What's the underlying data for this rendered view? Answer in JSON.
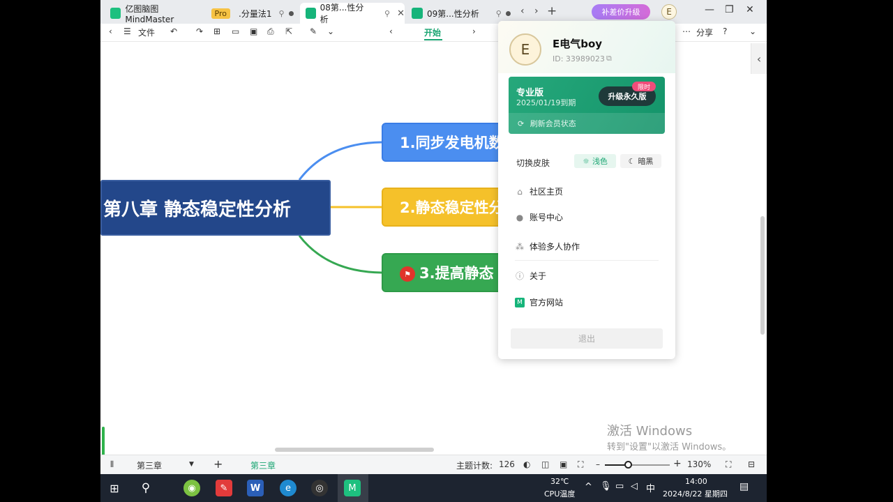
{
  "titlebar": {
    "tabs": [
      {
        "label": "亿图脑图MindMaster",
        "badge": "Pro"
      },
      {
        "label": ".分量法1"
      },
      {
        "label": "08第...性分析"
      },
      {
        "label": "09第...性分析"
      }
    ],
    "upgrade_label": "补差价升级",
    "avatar_letter": "E"
  },
  "toolbar": {
    "file_label": "文件",
    "start_label": "开始",
    "share_label": "分享"
  },
  "mindmap": {
    "central": "第八章 静态稳定性分析",
    "branches": [
      {
        "label": "1.同步发电机数",
        "color": "#4b8ef0"
      },
      {
        "label": "2.静态稳定性分",
        "color": "#f5c12a"
      },
      {
        "label": "3.提高静态",
        "color": "#36a852"
      }
    ]
  },
  "account_popup": {
    "avatar_letter": "E",
    "username": "E电气boy",
    "id_text": "ID: 33989023",
    "membership": {
      "plan": "专业版",
      "expiry": "2025/01/19到期",
      "upgrade_button": "升级永久版",
      "limited_badge": "限时",
      "refresh_label": "刷新会员状态"
    },
    "skin": {
      "label": "切换皮肤",
      "light": "浅色",
      "dark": "暗黑"
    },
    "menu": [
      {
        "label": "社区主页",
        "icon": "home-icon"
      },
      {
        "label": "账号中心",
        "icon": "user-icon"
      },
      {
        "label": "体验多人协作",
        "icon": "share-nodes-icon"
      },
      {
        "label": "关于",
        "icon": "info-icon"
      },
      {
        "label": "官方网站",
        "icon": "website-icon"
      }
    ],
    "logout_label": "退出"
  },
  "watermark": {
    "line1": "激活 Windows",
    "line2": "转到\"设置\"以激活 Windows。"
  },
  "statusbar": {
    "page_name": "第三章",
    "current_page_tab": "第三章",
    "topic_count_label": "主题计数:",
    "topic_count": "126",
    "zoom": "130%",
    "zoom_fraction": 0.36
  },
  "taskbar": {
    "temp": "32℃",
    "temp_label": "CPU温度",
    "ime": "中",
    "time": "14:00",
    "date": "2024/8/22 星期四"
  }
}
